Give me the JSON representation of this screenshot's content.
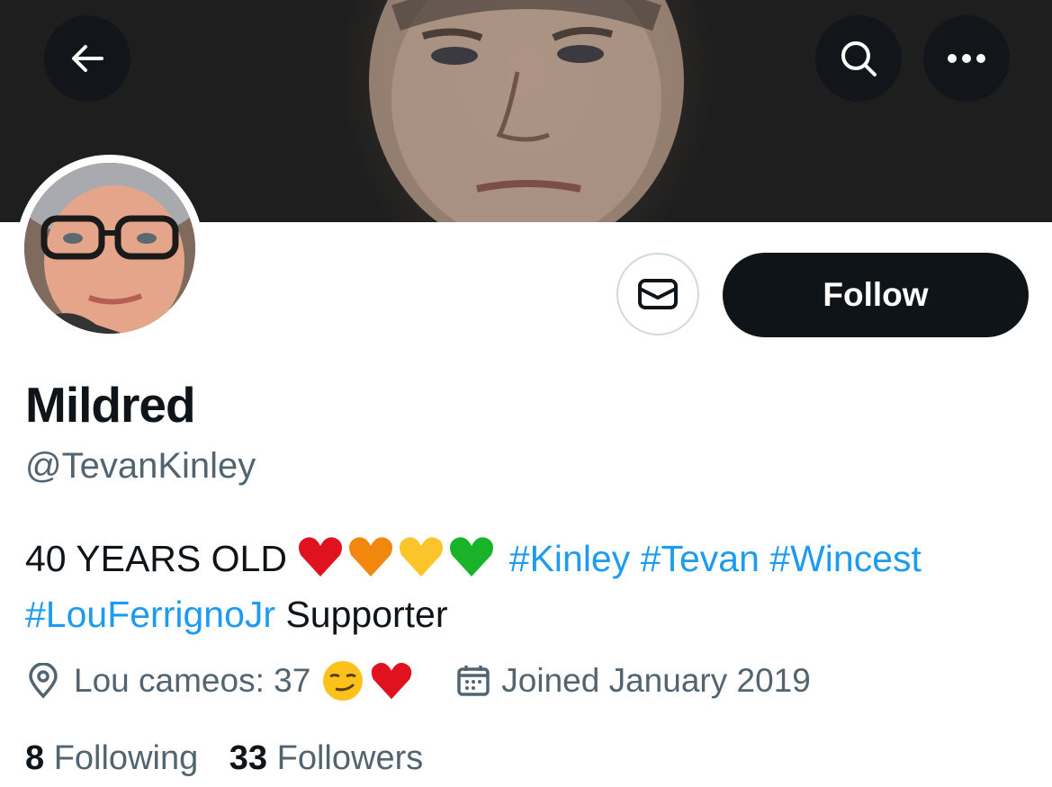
{
  "header": {
    "back_icon": "arrow-left-icon",
    "search_icon": "search-icon",
    "more_icon": "more-horizontal-icon"
  },
  "actions": {
    "message_icon": "envelope-icon",
    "follow_label": "Follow"
  },
  "profile": {
    "name": "Mildred",
    "handle": "@TevanKinley",
    "bio": {
      "text_start": "40 YEARS OLD",
      "emojis": [
        "red-heart",
        "orange-heart",
        "yellow-heart",
        "green-heart"
      ],
      "hashtags_line1": [
        "#Kinley",
        "#Tevan",
        "#Wincest"
      ],
      "hashtag_line2": "#LouFerrignoJr",
      "text_end": "Supporter"
    },
    "location": "Lou cameos: 37",
    "location_emojis": [
      "smirking-face",
      "red-heart"
    ],
    "joined": "Joined January 2019",
    "following_count": "8",
    "following_label": "Following",
    "followers_count": "33",
    "followers_label": "Followers"
  },
  "colors": {
    "accent": "#1d9bf0",
    "text": "#0f1419",
    "secondary": "#536471",
    "follow_bg": "#0f1419"
  }
}
